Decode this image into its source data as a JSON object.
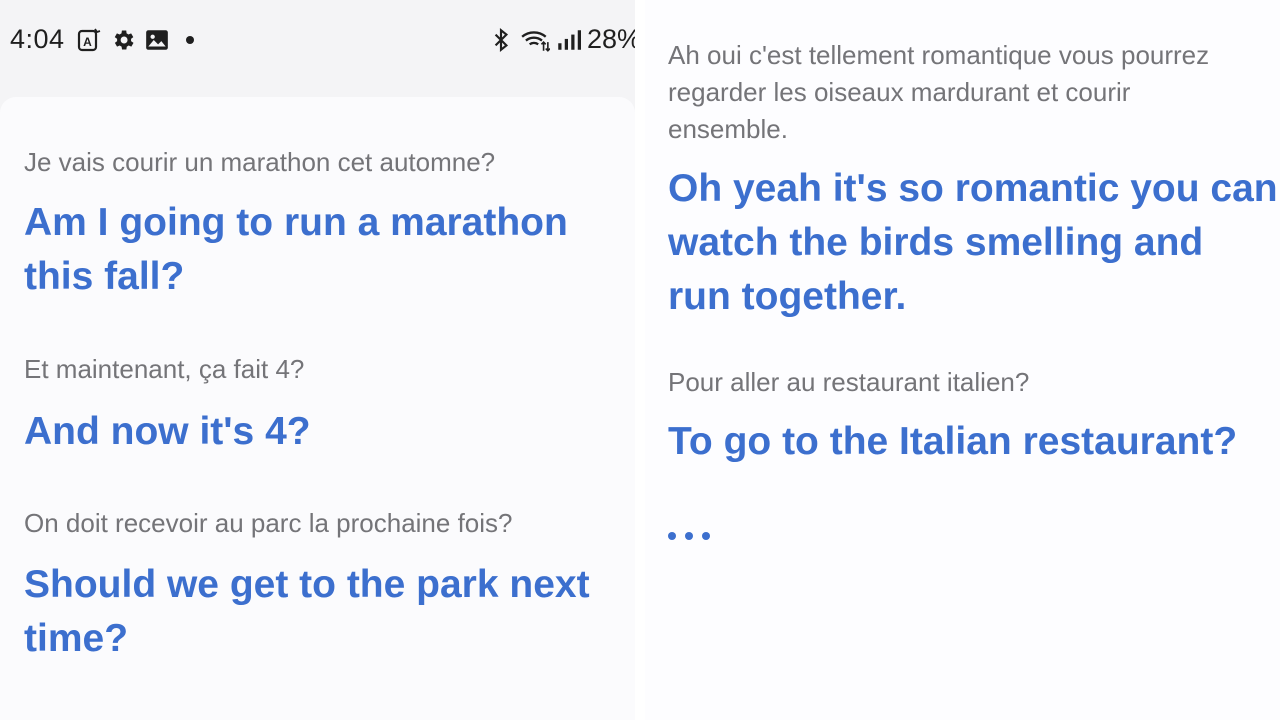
{
  "status_bar": {
    "time": "4:04",
    "battery": "28%",
    "icons": [
      "auto-translate-icon",
      "gear-icon",
      "image-icon",
      "bluetooth-icon",
      "wifi-icon",
      "signal-icon"
    ]
  },
  "colors": {
    "translation": "#3c6fce",
    "source": "#747478",
    "panel_bg": "#fbfbfd"
  },
  "left": {
    "entries": [
      {
        "source": "Je vais courir un marathon cet automne?",
        "translation_lines": [
          "Am I going to run a marathon",
          "this fall?"
        ]
      },
      {
        "source": "Et maintenant, ça fait 4?",
        "translation_lines": [
          "And now it's 4?"
        ]
      },
      {
        "source": "On doit recevoir au parc la prochaine fois?",
        "translation_lines": [
          "Should we get to the park next",
          "time?"
        ]
      }
    ]
  },
  "right": {
    "entries": [
      {
        "source_lines": [
          "Ah oui c'est tellement romantique vous pourrez",
          "regarder les oiseaux mardurant et courir",
          "ensemble."
        ],
        "translation_lines": [
          "Oh yeah it's so romantic you can",
          "watch the birds smelling and",
          "run together."
        ]
      },
      {
        "source_lines": [
          "Pour aller au restaurant italien?"
        ],
        "translation_lines": [
          "To go to the Italian restaurant?"
        ]
      }
    ],
    "listening_indicator": "typing-dots"
  }
}
